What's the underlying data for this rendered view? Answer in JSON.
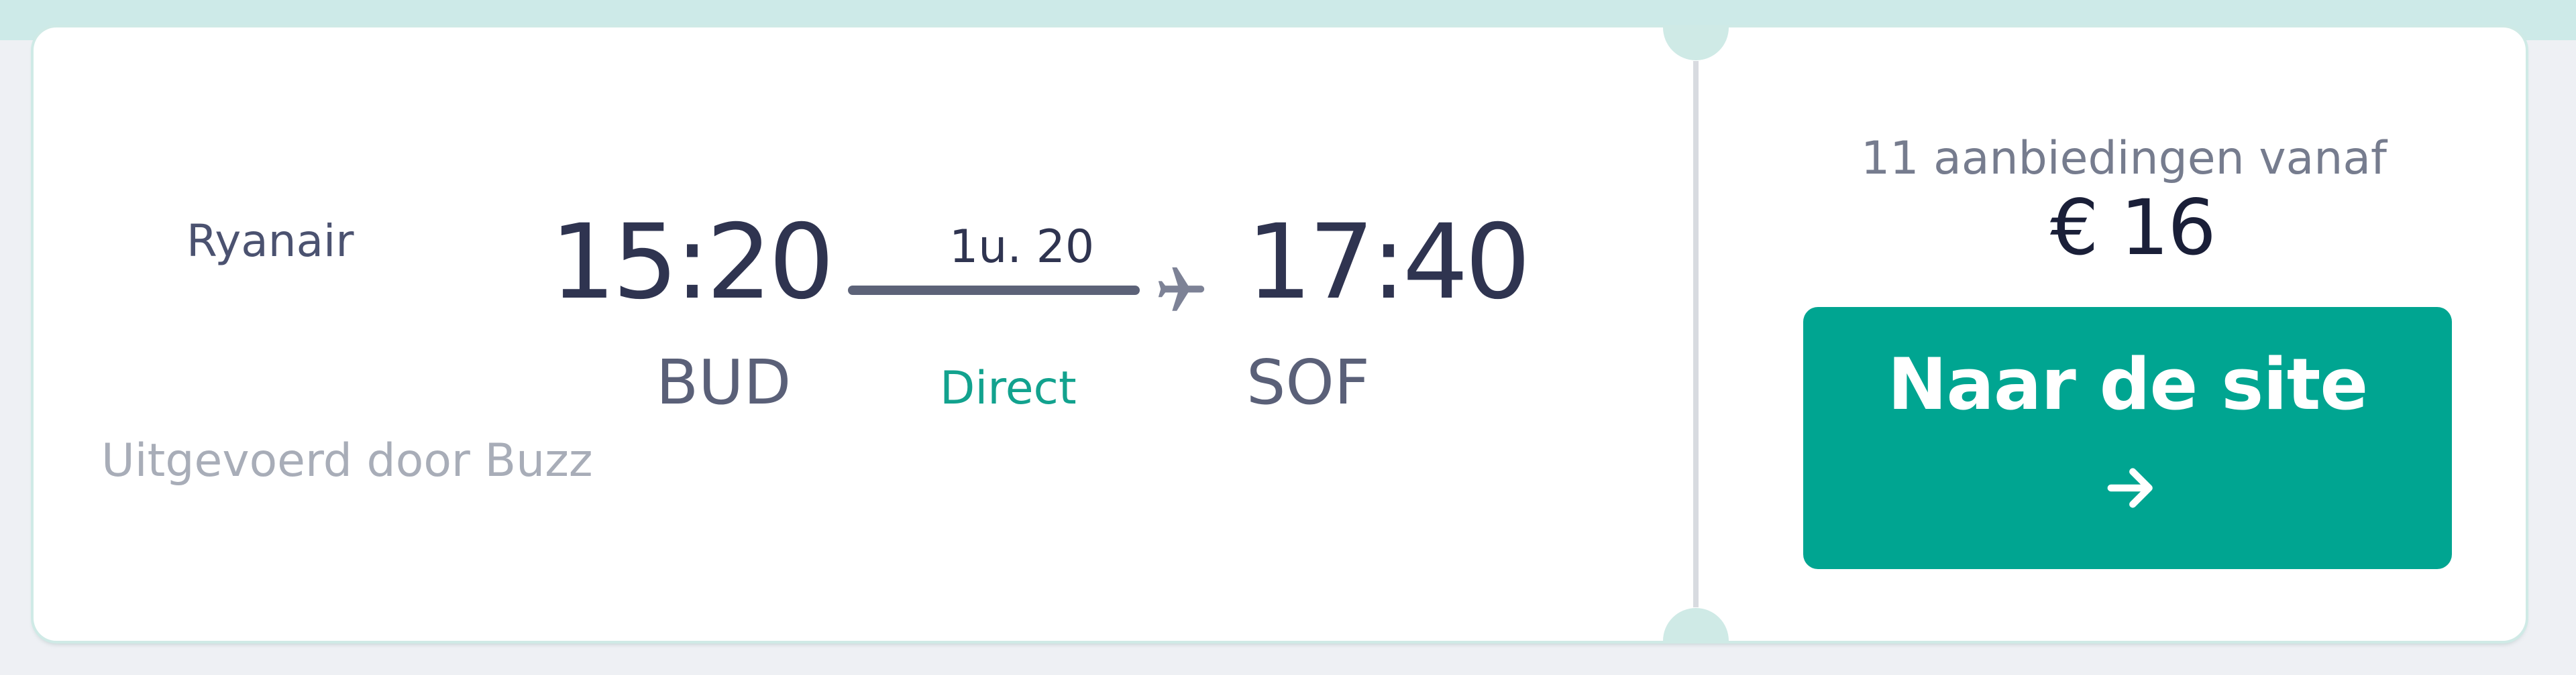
{
  "flight": {
    "airline": "Ryanair",
    "operated_by": "Uitgevoerd door Buzz",
    "departure": {
      "time": "15:20",
      "airport": "BUD"
    },
    "arrival": {
      "time": "17:40",
      "airport": "SOF"
    },
    "duration": "1u. 20",
    "stops": "Direct",
    "plane_icon": "airplane-icon"
  },
  "pricing": {
    "offers_text": "11 aanbiedingen vanaf",
    "price": "€ 16",
    "cta_label": "Naar de site",
    "cta_icon": "arrow-right-icon"
  },
  "colors": {
    "accent": "#00a591",
    "direct_text": "#12a28e",
    "band": "#cdeae8",
    "background": "#eef0f4"
  }
}
